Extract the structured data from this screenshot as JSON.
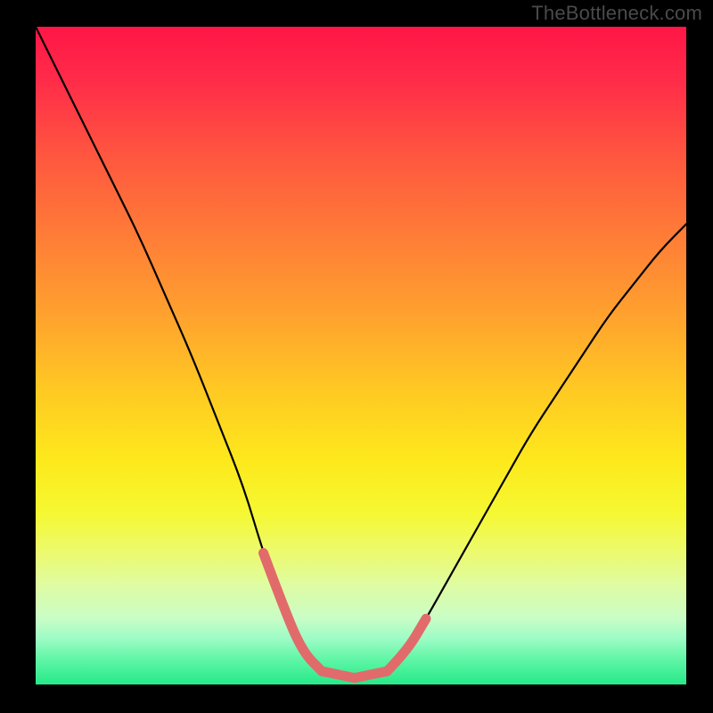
{
  "watermark": "TheBottleneck.com",
  "chart_data": {
    "type": "line",
    "title": "",
    "xlabel": "",
    "ylabel": "",
    "xlim": [
      0,
      100
    ],
    "ylim": [
      0,
      100
    ],
    "x": [
      0,
      4,
      8,
      12,
      16,
      20,
      24,
      28,
      32,
      35,
      38,
      41,
      44,
      46,
      50,
      54,
      57,
      60,
      64,
      68,
      72,
      76,
      80,
      84,
      88,
      92,
      96,
      100
    ],
    "y": [
      100,
      92,
      84,
      76,
      68,
      59,
      50,
      40,
      30,
      20,
      12,
      5,
      2,
      1,
      1,
      2,
      5,
      10,
      17,
      24,
      31,
      38,
      44,
      50,
      56,
      61,
      66,
      70
    ],
    "highlight_segments": [
      {
        "x": [
          35,
          38,
          41,
          44
        ],
        "y": [
          20,
          12,
          5,
          2
        ]
      },
      {
        "x": [
          54,
          57,
          60
        ],
        "y": [
          2,
          5,
          10
        ]
      }
    ],
    "gradient_stops": [
      {
        "pos": 0.0,
        "color": "#ff1646"
      },
      {
        "pos": 0.5,
        "color": "#ffc823"
      },
      {
        "pos": 0.74,
        "color": "#f5f832"
      },
      {
        "pos": 1.0,
        "color": "#26e989"
      }
    ]
  }
}
